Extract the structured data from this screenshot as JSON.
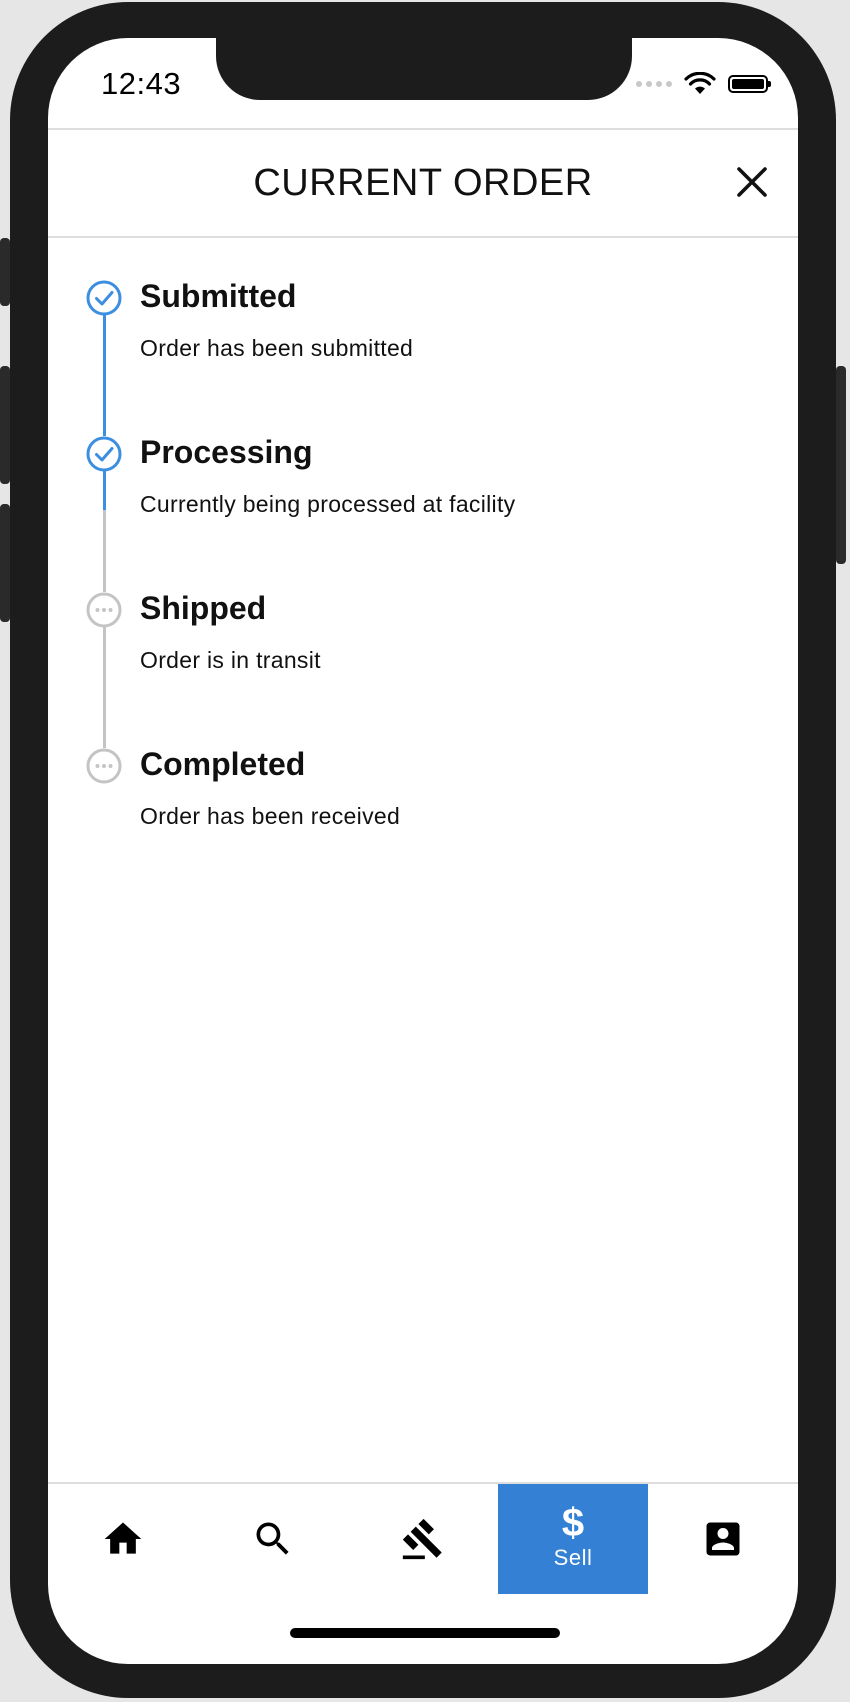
{
  "status_bar": {
    "time": "12:43"
  },
  "header": {
    "title": "CURRENT ORDER",
    "close_icon": "close-icon"
  },
  "colors": {
    "accent": "#3480d4",
    "completed_step": "#3b8ee0",
    "pending_step": "#c4c4c4",
    "divider": "#dedede"
  },
  "timeline": {
    "steps": [
      {
        "title": "Submitted",
        "description": "Order has been submitted",
        "state": "completed",
        "icon": "check-circle-icon"
      },
      {
        "title": "Processing",
        "description": "Currently being processed at facility",
        "state": "completed",
        "icon": "check-circle-icon"
      },
      {
        "title": "Shipped",
        "description": "Order is in transit",
        "state": "pending",
        "icon": "pending-circle-icon"
      },
      {
        "title": "Completed",
        "description": "Order has been received",
        "state": "pending",
        "icon": "pending-circle-icon"
      }
    ]
  },
  "bottom_nav": {
    "items": [
      {
        "icon": "home-icon",
        "label": ""
      },
      {
        "icon": "search-icon",
        "label": ""
      },
      {
        "icon": "gavel-icon",
        "label": ""
      },
      {
        "icon": "dollar-icon",
        "label": "Sell",
        "active": true
      },
      {
        "icon": "account-box-icon",
        "label": ""
      }
    ]
  }
}
